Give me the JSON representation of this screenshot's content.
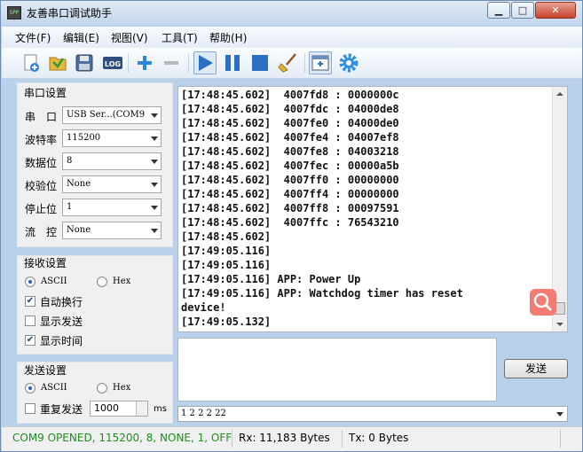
{
  "window": {
    "title": "友善串口调试助手",
    "icon_text": "SPP",
    "minimize_glyph": "▁",
    "maximize_glyph": "□",
    "close_glyph": "✕"
  },
  "menu": [
    {
      "label": "文件(F)"
    },
    {
      "label": "编辑(E)"
    },
    {
      "label": "视图(V)"
    },
    {
      "label": "工具(T)"
    },
    {
      "label": "帮助(H)"
    }
  ],
  "toolbar": {
    "buttons": [
      {
        "icon": "new-icon"
      },
      {
        "icon": "open-folder-icon"
      },
      {
        "icon": "save-icon"
      },
      {
        "icon": "log-icon",
        "text": "LOG"
      },
      {
        "icon": "plus-icon"
      },
      {
        "icon": "minus-icon"
      },
      {
        "icon": "play-icon"
      },
      {
        "icon": "pause-icon"
      },
      {
        "icon": "stop-icon"
      },
      {
        "icon": "broom-icon"
      },
      {
        "icon": "window-icon"
      },
      {
        "icon": "gear-icon"
      }
    ]
  },
  "serial": {
    "group_title": "串口设置",
    "port_label": "串　口",
    "port_value": "USB Ser...(COM9",
    "baud_label": "波特率",
    "baud_value": "115200",
    "databits_label": "数据位",
    "databits_value": "8",
    "parity_label": "校验位",
    "parity_value": "None",
    "stopbits_label": "停止位",
    "stopbits_value": "1",
    "flow_label": "流　控",
    "flow_value": "None"
  },
  "receive": {
    "group_title": "接收设置",
    "ascii_label": "ASCII",
    "hex_label": "Hex",
    "auto_wrap_label": "自动换行",
    "auto_wrap": true,
    "show_send_label": "显示发送",
    "show_send": false,
    "show_time_label": "显示时间",
    "show_time": true
  },
  "send": {
    "group_title": "发送设置",
    "ascii_label": "ASCII",
    "hex_label": "Hex",
    "repeat_label": "重复发送",
    "repeat": false,
    "interval_value": "1000",
    "interval_unit": "ms",
    "send_button": "发送",
    "history_value": "1 2 2 2 22"
  },
  "terminal": {
    "lines": [
      "[17:48:45.602]  4007fd8 : 0000000c",
      "[17:48:45.602]  4007fdc : 04000de8",
      "[17:48:45.602]  4007fe0 : 04000de0",
      "[17:48:45.602]  4007fe4 : 04007ef8",
      "[17:48:45.602]  4007fe8 : 04003218",
      "[17:48:45.602]  4007fec : 00000a5b",
      "[17:48:45.602]  4007ff0 : 00000000",
      "[17:48:45.602]  4007ff4 : 00000000",
      "[17:48:45.602]  4007ff8 : 00097591",
      "[17:48:45.602]  4007ffc : 76543210",
      "[17:48:45.602]",
      "[17:49:05.116]",
      "[17:49:05.116]",
      "[17:49:05.116] APP: Power Up",
      "[17:49:05.116] APP: Watchdog timer has reset",
      "device!",
      "[17:49:05.132]"
    ]
  },
  "status": {
    "connection": "COM9 OPENED, 115200, 8, NONE, 1, OFF",
    "rx": "Rx: 11,183 Bytes",
    "tx": "Tx: 0 Bytes"
  },
  "colors": {
    "status_ok": "#1a8f1a",
    "accent": "#2b6fc2",
    "search_fab": "#f27b72"
  }
}
